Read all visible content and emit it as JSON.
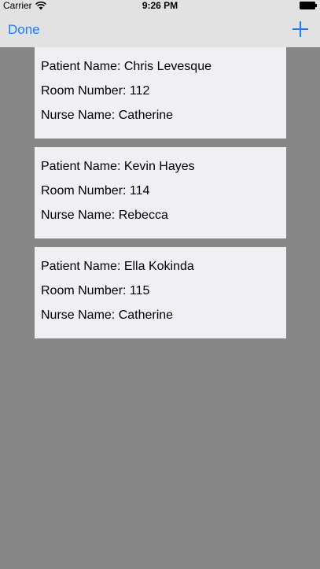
{
  "status_bar": {
    "carrier": "Carrier",
    "time": "9:26 PM",
    "wifi_icon": "wifi-icon",
    "battery_icon": "battery-icon"
  },
  "nav": {
    "done_label": "Done",
    "add_icon": "plus-icon",
    "accent_color": "#1a7ef5"
  },
  "patients": [
    {
      "patient_label": "Patient Name: Chris Levesque",
      "room_label": "Room Number: 112",
      "nurse_label": "Nurse Name: Catherine"
    },
    {
      "patient_label": "Patient Name: Kevin Hayes",
      "room_label": "Room Number: 114",
      "nurse_label": "Nurse Name: Rebecca"
    },
    {
      "patient_label": "Patient Name: Ella Kokinda",
      "room_label": "Room Number: 115",
      "nurse_label": "Nurse Name: Catherine"
    }
  ]
}
